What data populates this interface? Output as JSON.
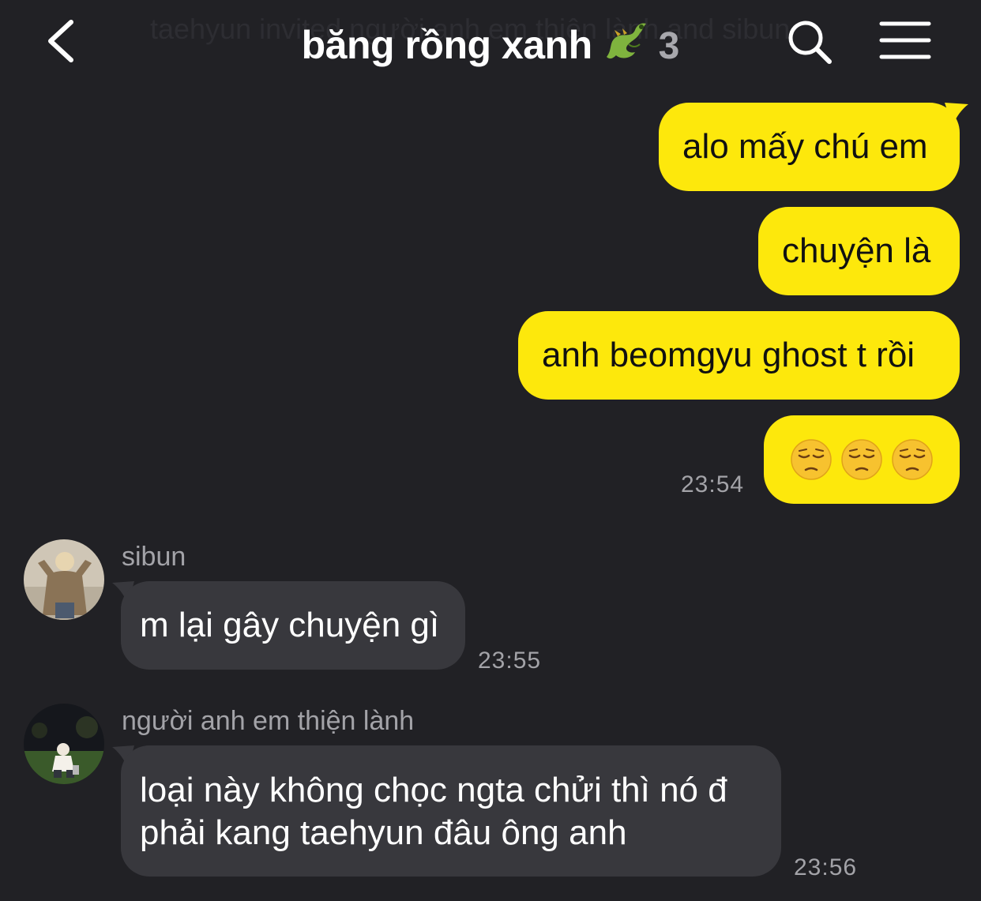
{
  "header": {
    "back_icon": "chevron-left-icon",
    "subtitle_ghost": "taehyun invited người anh em thiện lành and sibun",
    "title": "băng rồng xanh",
    "title_emoji": "dragon-emoji",
    "member_count": "3",
    "search_icon": "search-icon",
    "menu_icon": "hamburger-menu-icon"
  },
  "outgoing": [
    {
      "text": "alo mấy chú em"
    },
    {
      "text": "chuyện là"
    },
    {
      "text": "anh beomgyu ghost t rồi"
    },
    {
      "emoji": "pensive-face",
      "count": 3
    }
  ],
  "outgoing_time": "23:54",
  "incoming": [
    {
      "sender": "sibun",
      "text": "m lại gây chuyện gì",
      "time": "23:55"
    },
    {
      "sender": "người anh em thiện lành",
      "text_line1": "loại này không chọc ngta chửi thì nó đ",
      "text_line2": "phải kang taehyun đâu ông anh",
      "time": "23:56"
    }
  ],
  "colors": {
    "background": "#212125",
    "outgoing_bubble": "#fde80c",
    "incoming_bubble": "#38383d",
    "meta_text": "#a3a3a8"
  }
}
